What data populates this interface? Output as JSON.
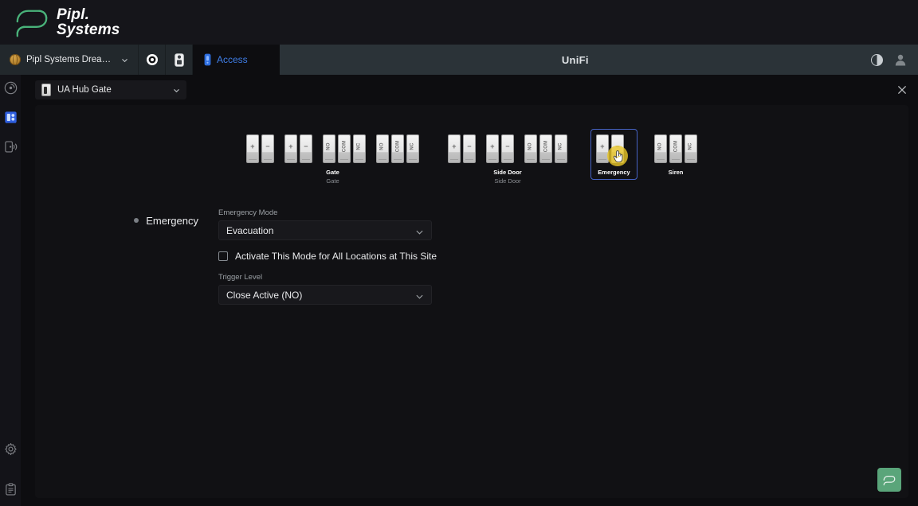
{
  "brand": {
    "line1": "Pipl.",
    "line2": "Systems",
    "logo_icon": "pipl-logo-icon"
  },
  "topbar": {
    "site_name": "Pipl Systems Dream Machin...",
    "site_icon": "globe-icon",
    "site_chevron": "chevron-down-icon",
    "icons": [
      {
        "name": "protect-camera-icon"
      },
      {
        "name": "access-reader-icon"
      }
    ],
    "tab": {
      "label": "Access",
      "icon": "access-device-icon"
    },
    "title": "UniFi",
    "theme_toggle_icon": "contrast-half-moon-icon",
    "account_icon": "user-avatar-icon"
  },
  "rail": {
    "items": [
      {
        "name": "rail-item-dashboard",
        "icon": "radar-icon",
        "active": false
      },
      {
        "name": "rail-item-devices",
        "icon": "door-hub-icon",
        "active": true
      },
      {
        "name": "rail-item-readers",
        "icon": "reader-signal-icon",
        "active": false
      }
    ],
    "bottom": [
      {
        "name": "rail-item-settings",
        "icon": "gear-icon"
      },
      {
        "name": "rail-item-logs",
        "icon": "clipboard-icon"
      }
    ]
  },
  "device_selector": {
    "value": "UA Hub Gate",
    "device_icon": "hub-device-icon",
    "chevron": "chevron-down-icon"
  },
  "close_button": {
    "icon": "close-icon"
  },
  "diagram": {
    "groups": [
      {
        "name": "gate",
        "label": "Gate",
        "sublabel": "Gate",
        "selected": false,
        "pinsets": [
          {
            "pins": [
              {
                "label": "+",
                "rotated": false
              },
              {
                "label": "−",
                "rotated": false
              }
            ]
          },
          {
            "pins": [
              {
                "label": "+",
                "rotated": false
              },
              {
                "label": "−",
                "rotated": false
              }
            ]
          },
          {
            "pins": [
              {
                "label": "NO",
                "rotated": true
              },
              {
                "label": "COM",
                "rotated": true
              },
              {
                "label": "NC",
                "rotated": true
              }
            ]
          },
          {
            "pins": [
              {
                "label": "NO",
                "rotated": true
              },
              {
                "label": "COM",
                "rotated": true
              },
              {
                "label": "NC",
                "rotated": true
              }
            ]
          }
        ]
      },
      {
        "name": "side-door",
        "label": "Side Door",
        "sublabel": "Side Door",
        "selected": false,
        "pinsets": [
          {
            "pins": [
              {
                "label": "+",
                "rotated": false
              },
              {
                "label": "−",
                "rotated": false
              }
            ]
          },
          {
            "pins": [
              {
                "label": "+",
                "rotated": false
              },
              {
                "label": "−",
                "rotated": false
              }
            ]
          },
          {
            "pins": [
              {
                "label": "NO",
                "rotated": true
              },
              {
                "label": "COM",
                "rotated": true
              },
              {
                "label": "NC",
                "rotated": true
              }
            ]
          }
        ]
      },
      {
        "name": "emergency",
        "label": "Emergency",
        "sublabel": "",
        "selected": true,
        "cursor": {
          "icon": "hand-pointer-icon",
          "highlight_color": "#ebc828"
        },
        "pinsets": [
          {
            "pins": [
              {
                "label": "+",
                "rotated": false
              },
              {
                "label": "−",
                "rotated": false
              }
            ]
          }
        ]
      },
      {
        "name": "siren",
        "label": "Siren",
        "sublabel": "",
        "selected": false,
        "pinsets": [
          {
            "pins": [
              {
                "label": "NO",
                "rotated": true
              },
              {
                "label": "COM",
                "rotated": true
              },
              {
                "label": "NC",
                "rotated": true
              }
            ]
          }
        ]
      }
    ]
  },
  "form": {
    "section_label": "Emergency",
    "emergency_mode": {
      "label": "Emergency Mode",
      "value": "Evacuation",
      "chevron": "chevron-down-icon"
    },
    "activate_all": {
      "label": "Activate This Mode for All Locations at This Site",
      "checked": false
    },
    "trigger_level": {
      "label": "Trigger Level",
      "value": "Close Active (NO)",
      "chevron": "chevron-down-icon"
    }
  },
  "fab": {
    "name": "pipl-assistant-button",
    "icon": "pipl-logo-icon",
    "color": "#5aa57a"
  },
  "colors": {
    "page_bg": "#0d0d10",
    "brand_bg": "#15151a",
    "topbar_bg": "#2b3338",
    "panel_bg": "#111114",
    "accent_blue": "#3f7ee8",
    "selected_border": "#4663c4",
    "brand_green": "#49b27a"
  }
}
